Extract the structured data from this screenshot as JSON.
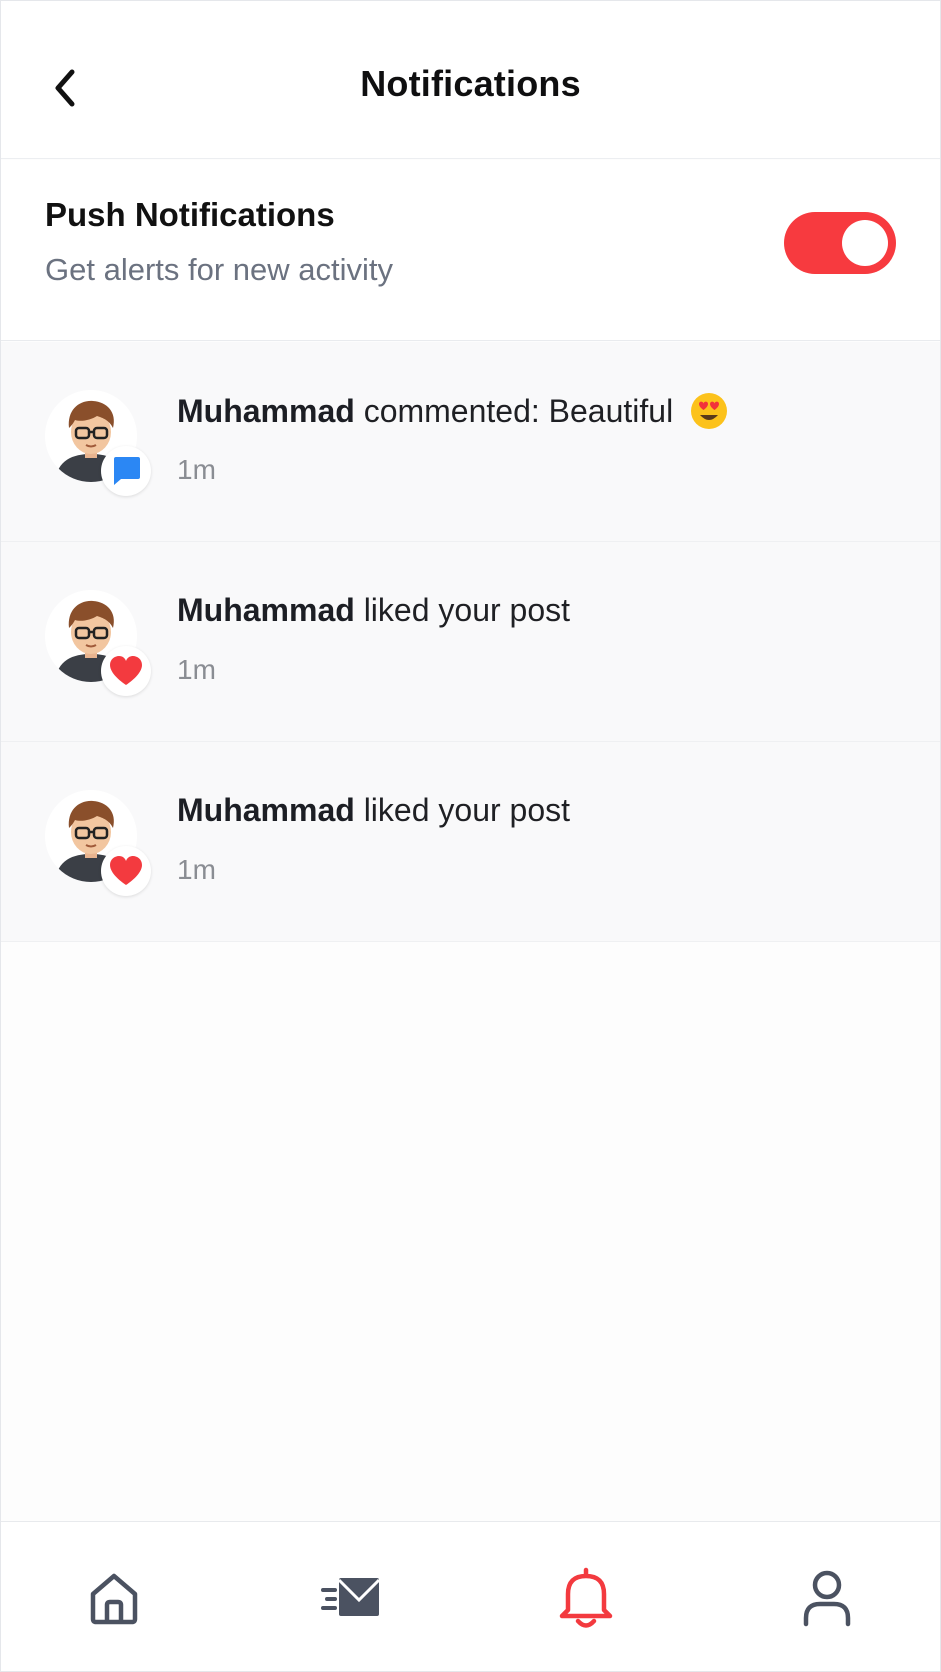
{
  "header": {
    "title": "Notifications",
    "back_icon": "chevron-left-icon"
  },
  "push": {
    "title": "Push Notifications",
    "subtitle": "Get alerts for new activity",
    "enabled": true,
    "accent_color": "#f73a3f"
  },
  "notifications": [
    {
      "name": "Muhammad",
      "action": "commented: Beautiful",
      "emoji": "heart-eyes-emoji",
      "time": "1m",
      "badge": "comment-bubble-icon",
      "badge_color": "#2b87f4"
    },
    {
      "name": "Muhammad",
      "action": "liked your post",
      "time": "1m",
      "badge": "heart-icon",
      "badge_color": "#f33a3f"
    },
    {
      "name": "Muhammad",
      "action": "liked your post",
      "time": "1m",
      "badge": "heart-icon",
      "badge_color": "#f33a3f"
    }
  ],
  "bottom_nav": {
    "items": [
      {
        "icon": "home-icon",
        "active": false
      },
      {
        "icon": "send-message-icon",
        "active": false
      },
      {
        "icon": "bell-icon",
        "active": true
      },
      {
        "icon": "profile-icon",
        "active": false
      }
    ],
    "active_color": "#f33a3f",
    "inactive_color": "#4b5261"
  }
}
